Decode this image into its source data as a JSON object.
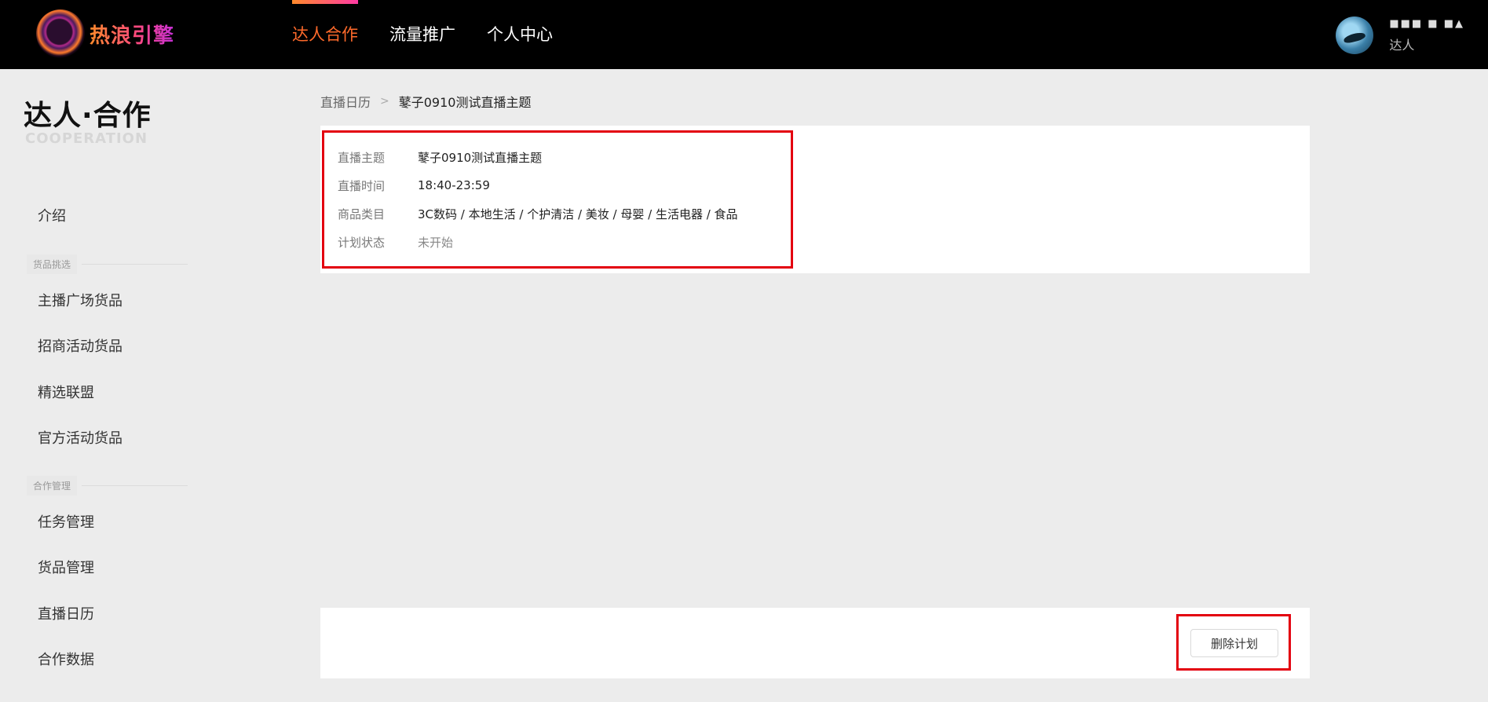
{
  "header": {
    "logo_text": "热浪引擎",
    "nav": [
      {
        "label": "达人合作",
        "active": true
      },
      {
        "label": "流量推广",
        "active": false
      },
      {
        "label": "个人中心",
        "active": false
      }
    ],
    "user": {
      "name": "■■■ ■ ■▲",
      "role": "达人"
    }
  },
  "sidebar": {
    "brand_title": "达人·合作",
    "brand_subtitle": "COOPERATION",
    "intro": "介绍",
    "group_goods": "货品挑选",
    "goods_items": [
      "主播广场货品",
      "招商活动货品",
      "精选联盟",
      "官方活动货品"
    ],
    "group_coop": "合作管理",
    "coop_items": [
      "任务管理",
      "货品管理",
      "直播日历",
      "合作数据"
    ]
  },
  "breadcrumb": {
    "parent": "直播日历",
    "separator": ">",
    "current": "鼕子0910测试直播主题"
  },
  "plan": {
    "topic_label": "直播主题",
    "topic": "鼕子0910测试直播主题",
    "time_label": "直播时间",
    "time": "18:40-23:59",
    "category_label": "商品类目",
    "category": "3C数码 / 本地生活 / 个护清洁 / 美妆 / 母婴 / 生活电器 / 食品",
    "status_label": "计划状态",
    "status": "未开始"
  },
  "actions": {
    "delete_label": "删除计划"
  },
  "colors": {
    "accent": "#ff6a2b",
    "highlight": "#e3000f",
    "topbar": "#000000"
  }
}
